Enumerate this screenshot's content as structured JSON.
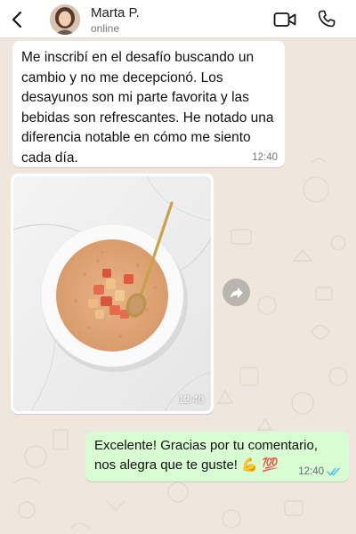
{
  "header": {
    "contact_name": "Marta P.",
    "status": "online",
    "icons": [
      "back-icon",
      "video-call-icon",
      "phone-icon"
    ]
  },
  "messages": [
    {
      "direction": "incoming",
      "text": "Me inscribí en el desafío buscando un cambio y no me decepcionó. Los desayunos son mi parte favorita y las bebidas son refrescantes. He notado una diferencia notable en cómo me siento cada día.",
      "time": "12:40"
    },
    {
      "direction": "incoming",
      "type": "image",
      "image_description": "bowl of oatmeal with diced apples and a gold spoon on marble",
      "time": "12:40"
    },
    {
      "direction": "outgoing",
      "text": "Excelente! Gracias por tu comentario, nos alegra que te guste! 💪 💯",
      "time": "12:40",
      "read": true
    }
  ],
  "colors": {
    "chat_background": "#efe7dd",
    "outgoing_bubble": "#d9fdd3",
    "incoming_bubble": "#ffffff",
    "read_ticks": "#53bdeb"
  }
}
